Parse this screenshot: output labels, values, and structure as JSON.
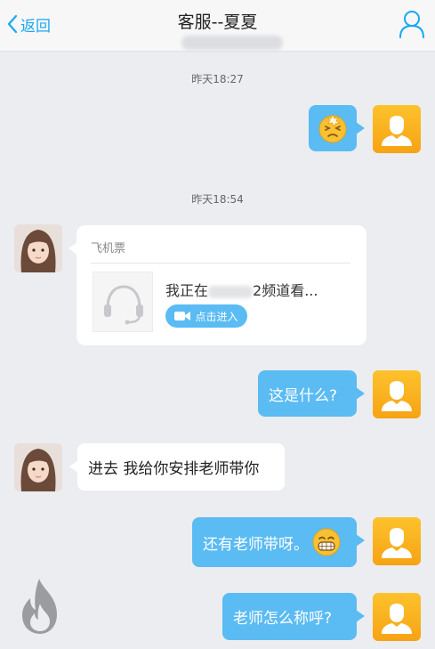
{
  "header": {
    "back_label": "返回",
    "title": "客服--夏夏"
  },
  "messages": {
    "ts1": "昨天18:27",
    "ts2": "昨天18:54",
    "card_label": "飞机票",
    "card_text_a": "我正在",
    "card_text_b": "2频道看...",
    "card_button": "点击进入",
    "q_what": "这是什么?",
    "reply_teacher": "进去 我给你安排老师带你",
    "teacher_too": "还有老师带呀。",
    "how_call": "老师怎么称呼?"
  },
  "colors": {
    "accent": "#18a8f0",
    "bubble_self": "#5bbbf3",
    "avatar_self": "#f7a314",
    "background": "#ebedf0"
  },
  "icons": {
    "back": "chevron-left-icon",
    "profile": "user-outline-icon",
    "dizzy_emoji": "dizzy-face-emoji",
    "grin_emoji": "grinning-face-emoji",
    "headset": "headset-icon",
    "video": "video-camera-icon",
    "fire": "fire-icon"
  }
}
